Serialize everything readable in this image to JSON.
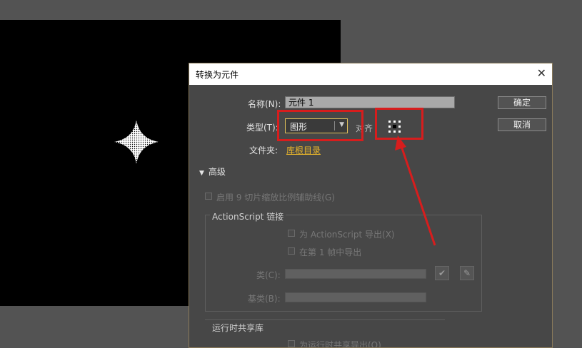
{
  "dialog": {
    "title": "转换为元件",
    "name_label": "名称(N):",
    "name_value": "元件 1",
    "type_label": "类型(T):",
    "type_value": "图形",
    "align_label": "对齐",
    "folder_label": "文件夹:",
    "folder_link": "库根目录",
    "ok_button": "确定",
    "cancel_button": "取消",
    "advanced_label": "高级",
    "scale9_label": "启用 9 切片缩放比例辅助线(G)",
    "actionscript_legend": "ActionScript 链接",
    "export_as_label": "为 ActionScript 导出(X)",
    "export_frame1_label": "在第 1 帧中导出",
    "class_label": "类(C):",
    "base_class_label": "基类(B):",
    "runtime_legend": "运行时共享库",
    "runtime_export_label": "为运行时共享导出(O)"
  },
  "colors": {
    "highlight": "#d71d1d",
    "link": "#e8b52b",
    "stage": "#000000",
    "workspace": "#535353"
  },
  "icons": {
    "close": "close-icon",
    "registration": "registration-grid-icon",
    "check": "checkmark-icon",
    "pencil": "pencil-icon",
    "star": "star-shape"
  }
}
